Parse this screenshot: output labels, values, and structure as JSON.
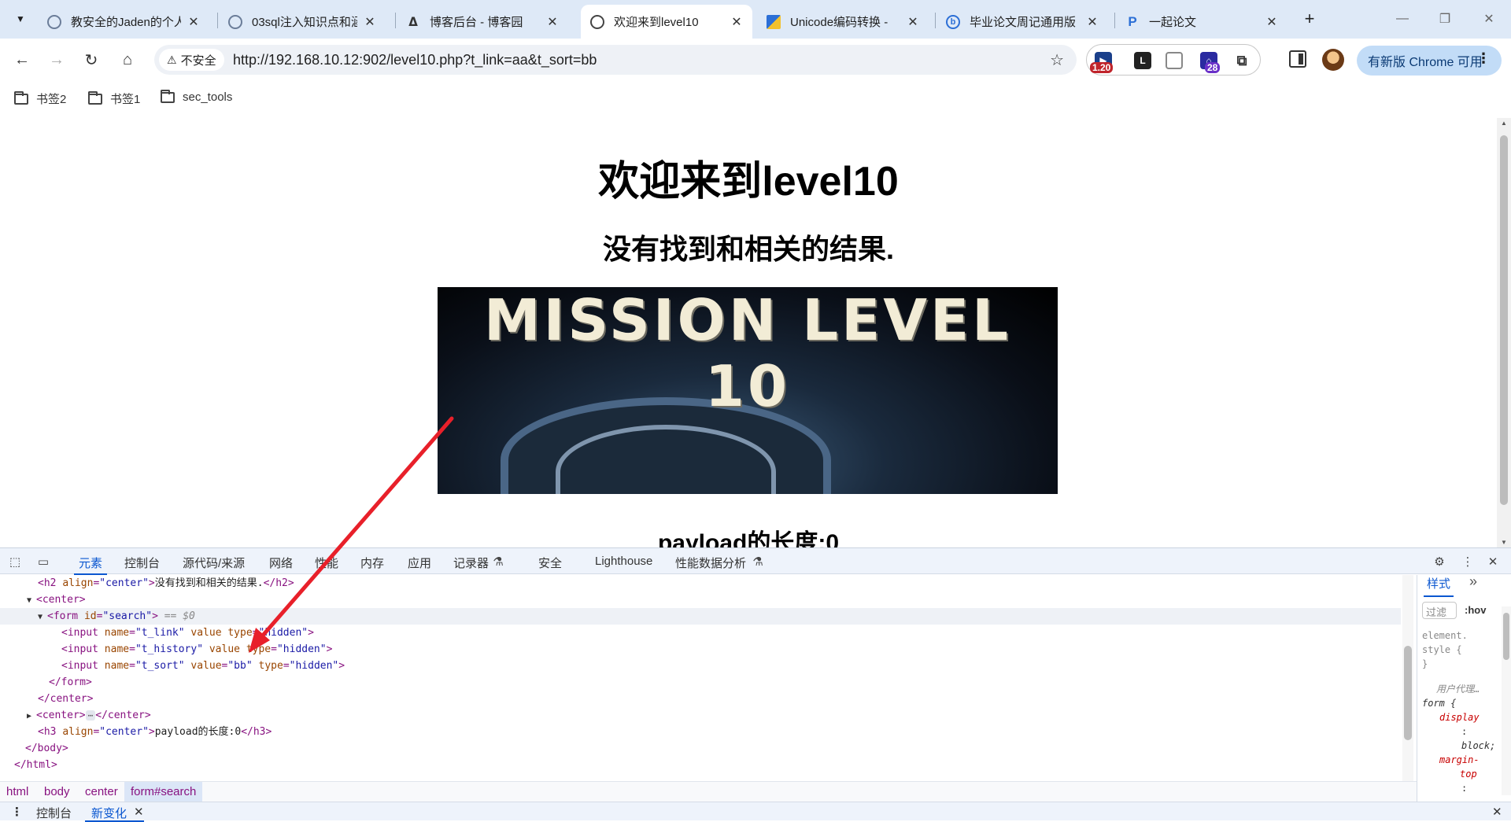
{
  "browser": {
    "tabs": [
      {
        "label": "教安全的Jaden的个人",
        "active": false
      },
      {
        "label": "03sql注入知识点和涵",
        "active": false
      },
      {
        "label": "博客后台 - 博客园",
        "active": false
      },
      {
        "label": "欢迎来到level10",
        "active": true
      },
      {
        "label": "Unicode编码转换 - ",
        "active": false
      },
      {
        "label": "毕业论文周记通用版",
        "active": false
      },
      {
        "label": "一起论文",
        "active": false
      }
    ],
    "security_label": "不安全",
    "url": "http://192.168.10.12:902/level10.php?t_link=aa&t_sort=bb",
    "ext_badge_1": "1.20",
    "ext_badge_2": "28",
    "update_label": "有新版 Chrome 可用",
    "bookmarks": [
      "书签2",
      "书签1",
      "sec_tools"
    ]
  },
  "page": {
    "h1": "欢迎来到level10",
    "h2": "没有找到和相关的结果.",
    "banner_text": "MISSION LEVEL 10",
    "h3": "payload的长度:0"
  },
  "devtools": {
    "tabs": [
      "元素",
      "控制台",
      "源代码/来源",
      "网络",
      "性能",
      "内存",
      "应用",
      "记录器",
      "安全",
      "Lighthouse",
      "性能数据分析"
    ],
    "dom_lines": {
      "l0_open": "<h2 ",
      "l0_attr": "align",
      "l0_val": "\"center\"",
      "l0_text": "没有找到和相关的结果.",
      "l0_close": "</h2>",
      "l1": "<center>",
      "l2_open": "<form ",
      "l2_attr": "id",
      "l2_val": "\"search\"",
      "l2_close": ">",
      "l2_eq": " == $0",
      "l3_attr1": "name",
      "l3_val1": "\"t_link\"",
      "l3_attr2": "value",
      "l3_attr3": "type",
      "l3_val3": "\"hidden\"",
      "l4_attr1": "name",
      "l4_val1": "\"t_history\"",
      "l4_attr2": "value",
      "l4_attr3": "type",
      "l4_val3": "\"hidden\"",
      "l5_attr1": "name",
      "l5_val1": "\"t_sort\"",
      "l5_attr2": "value",
      "l5_val2": "\"bb\"",
      "l5_attr3": "type",
      "l5_val3": "\"hidden\"",
      "input_tag": "<input ",
      "l6": "</form>",
      "l7": "</center>",
      "l8_open": "<center>",
      "l8_close": "</center>",
      "l9_open": "<h3 ",
      "l9_attr": "align",
      "l9_val": "\"center\"",
      "l9_text": "payload的长度:0",
      "l9_close": "</h3>",
      "l10": "</body>",
      "l11": "</html>"
    },
    "breadcrumbs": [
      "html",
      "body",
      "center",
      "form#search"
    ],
    "styles": {
      "tab": "样式",
      "filter": "过滤",
      "hov": ":hov",
      "element_style": "element.",
      "element_style2": "style {",
      "close_brace": "}",
      "ua_label": "用户代理…",
      "form_selector": "form {",
      "prop_display": "display",
      "colon": ":",
      "val_block": "block;",
      "prop_margin": "margin-",
      "prop_margin2": "top"
    },
    "drawer_tabs": [
      "控制台",
      "新变化"
    ]
  },
  "colors": {
    "accent": "#0b57d0",
    "tabstrip": "#dee9f7",
    "arrow": "#e8202a"
  }
}
